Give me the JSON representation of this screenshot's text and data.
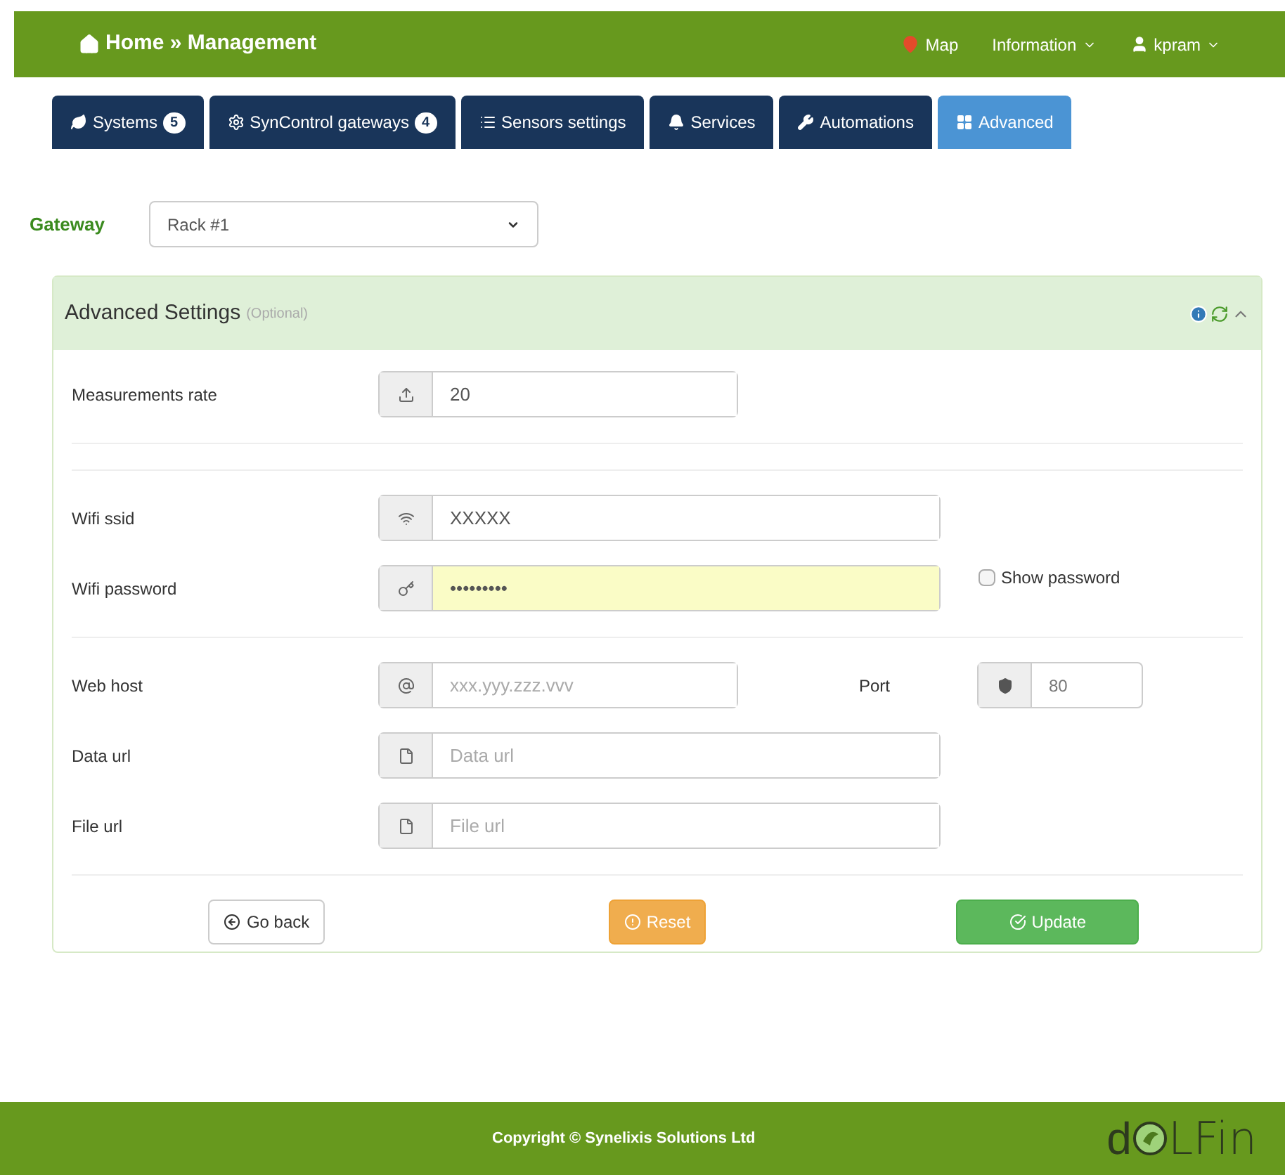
{
  "navbar": {
    "home": "Home",
    "separator": "»",
    "current": "Management",
    "links": [
      {
        "label": "Map",
        "kind": "map"
      },
      {
        "label": "Information",
        "kind": "dropdown"
      },
      {
        "label": "kpram",
        "kind": "user"
      }
    ]
  },
  "tabs": [
    {
      "label": "Systems",
      "badge": "5",
      "selected": false
    },
    {
      "label": "SynControl gateways",
      "badge": "4",
      "selected": false
    },
    {
      "label": "Sensors settings",
      "selected": false
    },
    {
      "label": "Services",
      "selected": false
    },
    {
      "label": "Automations",
      "selected": false
    },
    {
      "label": "Advanced",
      "selected": true
    }
  ],
  "gateway": {
    "label": "Gateway",
    "value": "Rack #1"
  },
  "panel": {
    "title": "Advanced Settings",
    "subtitle": "(Optional)",
    "expanded": true
  },
  "sections": [
    {
      "rows": [
        {
          "label": "Measurements rate",
          "kind": "short",
          "value": "20"
        }
      ]
    },
    {
      "rows": [
        {
          "label": "Wifi ssid",
          "kind": "wide",
          "value": "XXXXX"
        },
        {
          "label": "Wifi password",
          "kind": "wide",
          "value": "•••••••••",
          "autofilled": true,
          "option": {
            "label": "Show password",
            "checked": false
          }
        }
      ]
    },
    {
      "rows": [
        {
          "label": "Web host",
          "kind": "short",
          "placeholder": "xxx.yyy.zzz.vvv",
          "extra": {
            "label": "Port",
            "value": "80"
          }
        },
        {
          "label": "Data url",
          "kind": "wide",
          "placeholder": "Data url"
        },
        {
          "label": "File url",
          "kind": "wide",
          "placeholder": "File url"
        }
      ]
    }
  ],
  "buttons": [
    {
      "label": "Go back",
      "kind": "default"
    },
    {
      "label": "Reset",
      "kind": "warning"
    },
    {
      "label": "Update",
      "kind": "success"
    }
  ],
  "footer": {
    "copyright": "Copyright © Synelixis Solutions Ltd",
    "logo_start": "d",
    "logo_end": "LFin"
  }
}
